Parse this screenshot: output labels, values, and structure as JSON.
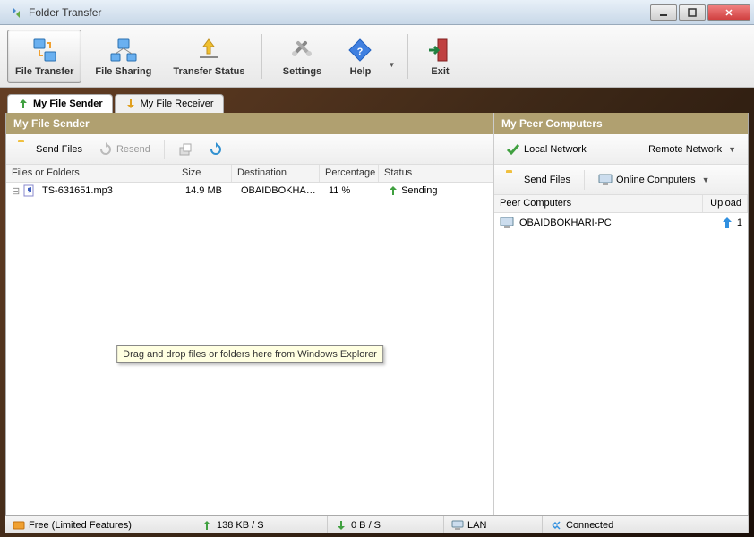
{
  "window": {
    "title": "Folder Transfer"
  },
  "toolbar": {
    "file_transfer": "File Transfer",
    "file_sharing": "File Sharing",
    "transfer_status": "Transfer Status",
    "settings": "Settings",
    "help": "Help",
    "exit": "Exit"
  },
  "tabs": {
    "sender": "My File Sender",
    "receiver": "My File Receiver"
  },
  "left": {
    "title": "My File Sender",
    "subbar": {
      "send": "Send Files",
      "resend": "Resend"
    },
    "columns": {
      "files": "Files or Folders",
      "size": "Size",
      "dest": "Destination",
      "pct": "Percentage",
      "status": "Status"
    },
    "rows": [
      {
        "name": "TS-631651.mp3",
        "size": "14.9 MB",
        "dest": "OBAIDBOKHAR...",
        "pct": "11 %",
        "status": "Sending"
      }
    ],
    "tooltip": "Drag and drop files or folders here from Windows Explorer"
  },
  "right": {
    "title": "My Peer Computers",
    "subbar": {
      "local": "Local Network",
      "remote": "Remote Network"
    },
    "subbar2": {
      "send": "Send Files",
      "online": "Online Computers"
    },
    "columns": {
      "name": "Peer Computers",
      "upload": "Upload"
    },
    "rows": [
      {
        "name": "OBAIDBOKHARI-PC",
        "upload": "1"
      }
    ]
  },
  "status": {
    "license": "Free (Limited Features)",
    "up": "138 KB / S",
    "down": "0 B / S",
    "net": "LAN",
    "conn": "Connected"
  }
}
